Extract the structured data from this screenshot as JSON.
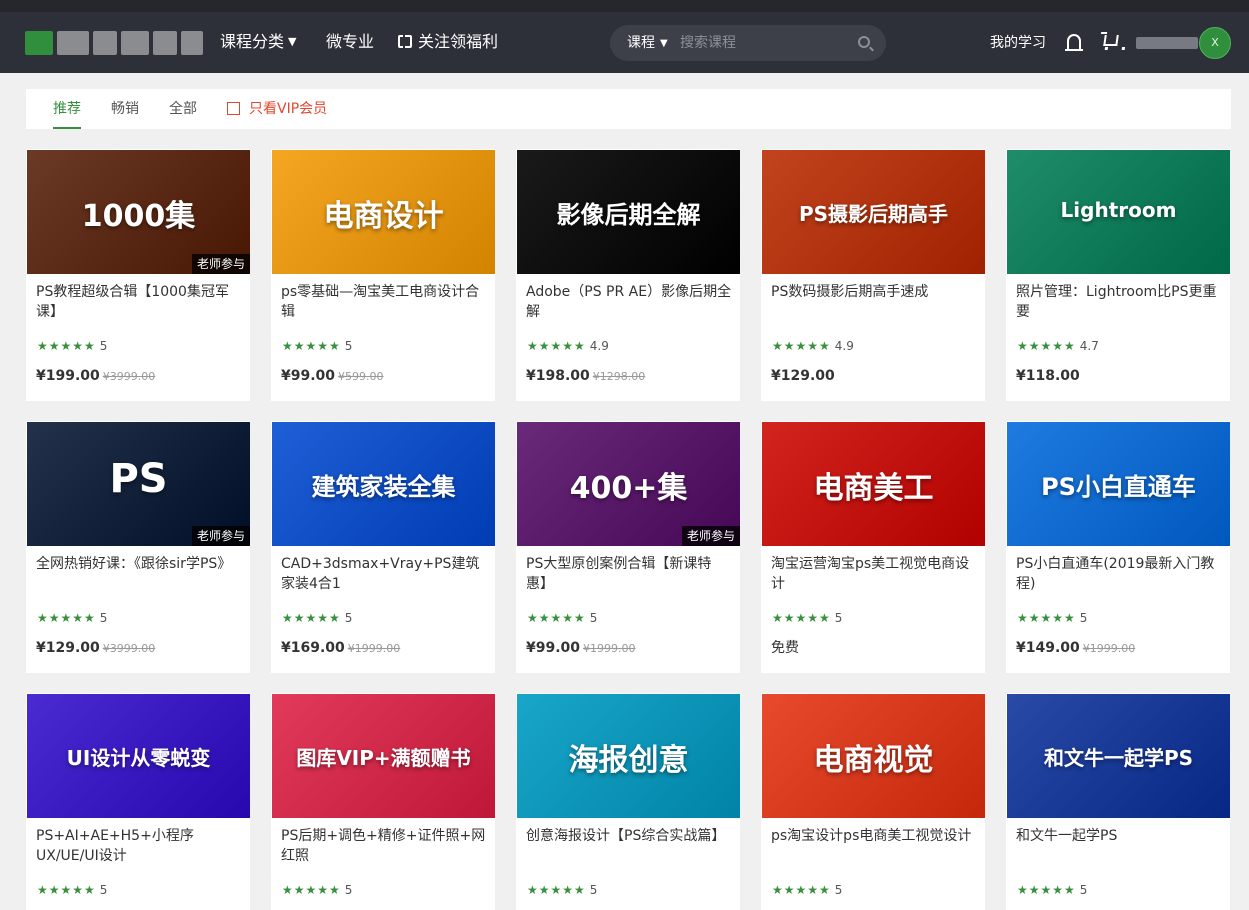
{
  "header": {
    "nav": {
      "category_label": "课程分类",
      "micro_major_label": "微专业",
      "follow_label": "关注领福利"
    },
    "search": {
      "category": "课程",
      "placeholder": "搜索课程"
    },
    "my_learning_label": "我的学习",
    "avatar_text": "X"
  },
  "filters": {
    "tabs": [
      {
        "label": "推荐"
      },
      {
        "label": "畅销"
      },
      {
        "label": "全部"
      }
    ],
    "vip_only_label": "只看VIP会员"
  },
  "courses": [
    {
      "title": "PS教程超级合辑【1000集冠军课】",
      "rating": "5",
      "price": "¥199.00",
      "orig_price": "¥3999.00",
      "badge": "老师参与",
      "thumb_text": "1000集",
      "thumb_color": "#6b3a26"
    },
    {
      "title": "ps零基础—淘宝美工电商设计合辑",
      "rating": "5",
      "price": "¥99.00",
      "orig_price": "¥599.00",
      "badge": "",
      "thumb_text": "电商设计",
      "thumb_color": "#f5a623"
    },
    {
      "title": "Adobe（PS PR AE）影像后期全解",
      "rating": "4.9",
      "price": "¥198.00",
      "orig_price": "¥1298.00",
      "badge": "",
      "thumb_text": "影像后期全解",
      "thumb_color": "#1a1a1a"
    },
    {
      "title": "PS数码摄影后期高手速成",
      "rating": "4.9",
      "price": "¥129.00",
      "orig_price": "",
      "badge": "",
      "thumb_text": "PS摄影后期高手",
      "thumb_color": "#c2441e"
    },
    {
      "title": "照片管理：Lightroom比PS更重要",
      "rating": "4.7",
      "price": "¥118.00",
      "orig_price": "",
      "badge": "",
      "thumb_text": "Lightroom",
      "thumb_color": "#1f8c6a"
    },
    {
      "title": "全网热销好课：《跟徐sir学PS》",
      "rating": "5",
      "price": "¥129.00",
      "orig_price": "¥3999.00",
      "badge": "老师参与",
      "thumb_text": "PS",
      "thumb_color": "#23324a"
    },
    {
      "title": "CAD+3dsmax+Vray+PS建筑家装4合1",
      "rating": "5",
      "price": "¥169.00",
      "orig_price": "¥1999.00",
      "badge": "",
      "thumb_text": "建筑家装全集",
      "thumb_color": "#1f5fd6"
    },
    {
      "title": "PS大型原创案例合辑【新课特惠】",
      "rating": "5",
      "price": "¥99.00",
      "orig_price": "¥1999.00",
      "badge": "老师参与",
      "thumb_text": "400+集",
      "thumb_color": "#6a2a7a"
    },
    {
      "title": "淘宝运营淘宝ps美工视觉电商设计",
      "rating": "5",
      "price": "免费",
      "orig_price": "",
      "badge": "",
      "thumb_text": "电商美工",
      "thumb_color": "#d3241e"
    },
    {
      "title": "PS小白直通车(2019最新入门教程)",
      "rating": "5",
      "price": "¥149.00",
      "orig_price": "¥1999.00",
      "badge": "",
      "thumb_text": "PS小白直通车",
      "thumb_color": "#1f7be0"
    },
    {
      "title": "PS+AI+AE+H5+小程序UX/UE/UI设计",
      "rating": "5",
      "price": "",
      "orig_price": "",
      "badge": "",
      "thumb_text": "UI设计从零蜕变",
      "thumb_color": "#4a2bd1"
    },
    {
      "title": "PS后期+调色+精修+证件照+网红照",
      "rating": "5",
      "price": "",
      "orig_price": "",
      "badge": "",
      "thumb_text": "图库VIP+满额赠书",
      "thumb_color": "#e23a5a"
    },
    {
      "title": "创意海报设计【PS综合实战篇】",
      "rating": "5",
      "price": "",
      "orig_price": "",
      "badge": "",
      "thumb_text": "海报创意",
      "thumb_color": "#19a6c9"
    },
    {
      "title": "ps淘宝设计ps电商美工视觉设计",
      "rating": "5",
      "price": "",
      "orig_price": "",
      "badge": "",
      "thumb_text": "电商视觉",
      "thumb_color": "#e84a2e"
    },
    {
      "title": "和文牛一起学PS",
      "rating": "5",
      "price": "",
      "orig_price": "",
      "badge": "",
      "thumb_text": "和文牛一起学PS",
      "thumb_color": "#2a4aa8"
    }
  ]
}
